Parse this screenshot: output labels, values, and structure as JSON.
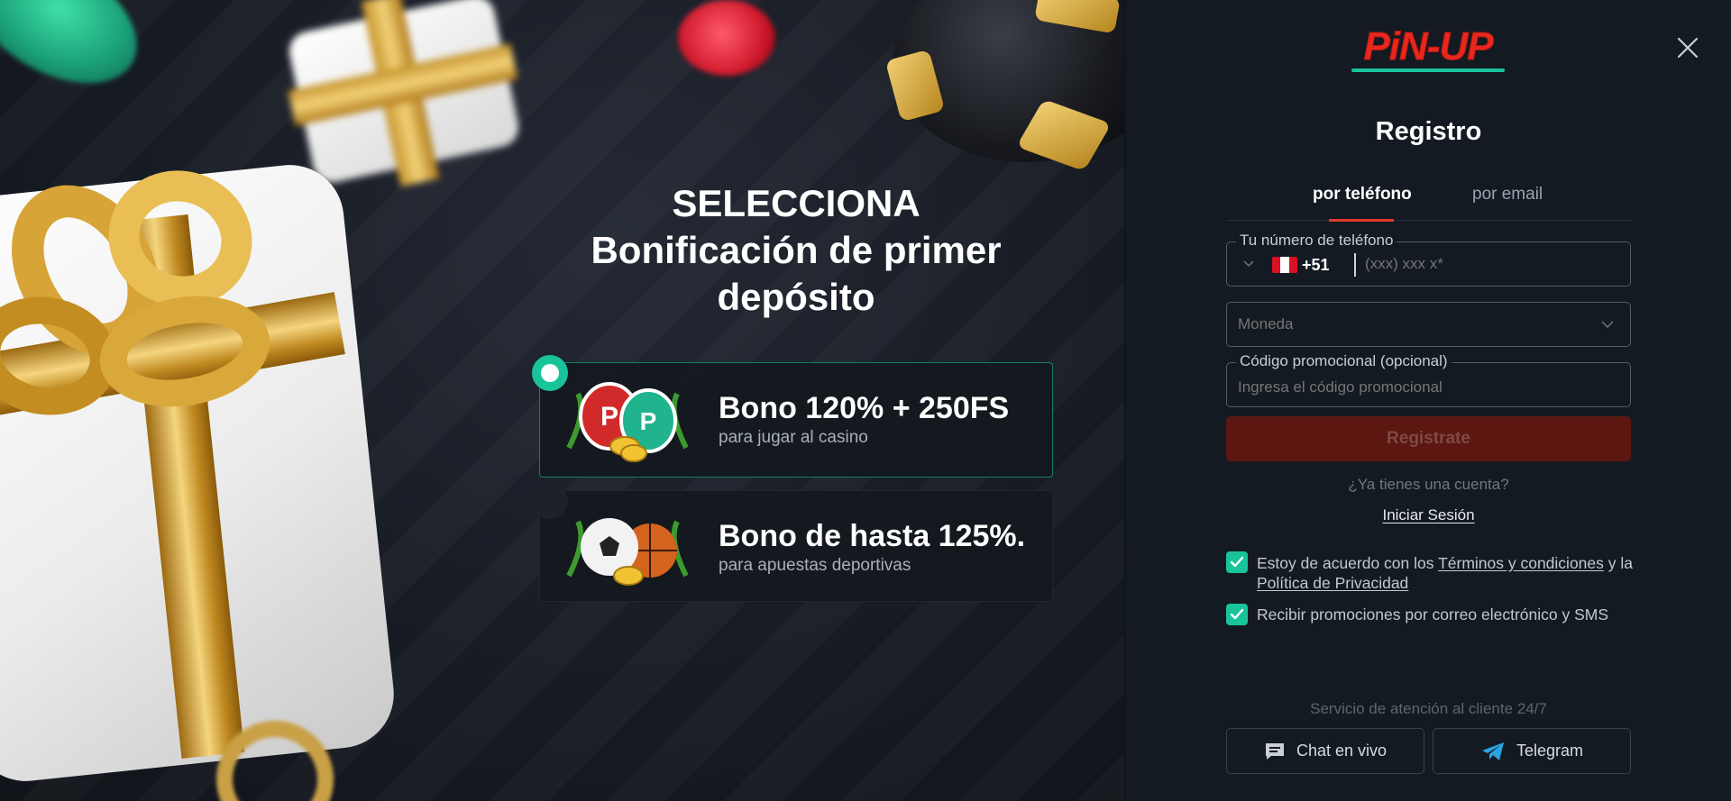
{
  "promo": {
    "title_line1": "SELECCIONA",
    "title_line2": "Bonificación de primer depósito",
    "bonuses": [
      {
        "title": "Bono 120% + 250FS",
        "subtitle": "para jugar al casino",
        "selected": true
      },
      {
        "title": "Bono de hasta 125%.",
        "subtitle": "para apuestas deportivas",
        "selected": false
      }
    ]
  },
  "header": {
    "logo_text": "PiN-UP",
    "close_icon": "close-icon"
  },
  "registration": {
    "title": "Registro",
    "tabs": [
      {
        "label": "por teléfono",
        "active": true
      },
      {
        "label": "por email",
        "active": false
      }
    ],
    "phone": {
      "label": "Tu número de teléfono",
      "country_code": "+51",
      "country": "Peru",
      "placeholder": "(xxx) xxx x*"
    },
    "currency": {
      "placeholder": "Moneda"
    },
    "promo_code": {
      "label": "Código promocional (opcional)",
      "placeholder": "Ingresa el código promocional"
    },
    "submit_label": "Registrate",
    "have_account": "¿Ya tienes una cuenta?",
    "login_label": "Iniciar Sesión",
    "terms": {
      "checked": true,
      "prefix": "Estoy de acuerdo con los ",
      "terms_link": "Términos y condiciones",
      "middle": " y la ",
      "privacy_link": "Política de Privacidad"
    },
    "promos_opt_in": {
      "checked": true,
      "label": "Recibir promociones por correo electrónico y SMS"
    }
  },
  "support": {
    "label": "Servicio de atención al cliente 24/7",
    "chat_label": "Chat en vivo",
    "telegram_label": "Telegram"
  },
  "colors": {
    "accent_green": "#19c49a",
    "brand_red": "#e03a2e",
    "submit_disabled": "#5c1711",
    "panel_bg": "#141a22"
  }
}
